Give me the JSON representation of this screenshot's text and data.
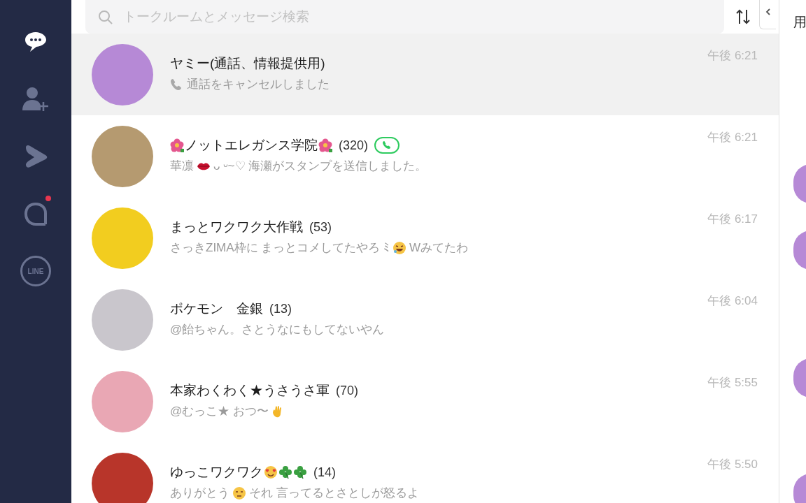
{
  "sidebar": {
    "items": [
      {
        "kind": "chats",
        "selected": true,
        "badge": false
      },
      {
        "kind": "add-friend",
        "selected": false,
        "badge": false
      },
      {
        "kind": "voom",
        "selected": false,
        "badge": false
      },
      {
        "kind": "openchat",
        "selected": false,
        "badge": true
      },
      {
        "kind": "line",
        "label": "LINE",
        "selected": false,
        "badge": false
      }
    ]
  },
  "search": {
    "placeholder": "トークルームとメッセージ検索"
  },
  "chats": [
    {
      "selected": true,
      "name": [
        {
          "kind": "text",
          "text": "ヤミー(通話、情報提供用)"
        }
      ],
      "call_active": false,
      "preview": [
        {
          "kind": "phone"
        },
        {
          "kind": "text",
          "text": "通話をキャンセルしました"
        }
      ],
      "time": "午後 6:21"
    },
    {
      "selected": false,
      "name": [
        {
          "kind": "hibiscus"
        },
        {
          "kind": "text",
          "text": "ノットエレガンス学院"
        },
        {
          "kind": "hibiscus"
        }
      ],
      "count": "(320)",
      "call_active": true,
      "preview": [
        {
          "kind": "text",
          "text": "華凛"
        },
        {
          "kind": "lips"
        },
        {
          "kind": "text",
          "text": "ᴗ ᵕ~♡ 海瀬がスタンプを送信しました。"
        }
      ],
      "time": "午後 6:21"
    },
    {
      "selected": false,
      "name": [
        {
          "kind": "text",
          "text": "まっとワクワク大作戦"
        }
      ],
      "count": "(53)",
      "call_active": false,
      "preview": [
        {
          "kind": "text",
          "text": "さっきZIMA枠に まっとコメしてたやろ ﾐ"
        },
        {
          "kind": "laughing"
        },
        {
          "kind": "text",
          "text": "Wみてたわ"
        }
      ],
      "time": "午後 6:17"
    },
    {
      "selected": false,
      "name": [
        {
          "kind": "text",
          "text": "ポケモン　金銀"
        }
      ],
      "count": "(13)",
      "call_active": false,
      "preview": [
        {
          "kind": "text",
          "text": "@飴ちゃん。さとうなにもしてないやん"
        }
      ],
      "time": "午後 6:04"
    },
    {
      "selected": false,
      "name": [
        {
          "kind": "text",
          "text": "本家わくわく★うさうさ軍"
        }
      ],
      "count": "(70)",
      "call_active": false,
      "preview": [
        {
          "kind": "text",
          "text": "@むっこ★ おつ〜"
        },
        {
          "kind": "hand"
        }
      ],
      "time": "午後 5:55"
    },
    {
      "selected": false,
      "name": [
        {
          "kind": "text",
          "text": "ゆっこワクワク"
        },
        {
          "kind": "heart-eyes"
        },
        {
          "kind": "clover"
        },
        {
          "kind": "clover"
        }
      ],
      "count": "(14)",
      "call_active": false,
      "preview": [
        {
          "kind": "text",
          "text": "ありがとう"
        },
        {
          "kind": "flat-face"
        },
        {
          "kind": "text",
          "text": "それ 言ってるとさとしが怒るよ"
        }
      ],
      "time": "午後 5:50"
    }
  ],
  "chat_panel": {
    "title_fragment": "用"
  }
}
